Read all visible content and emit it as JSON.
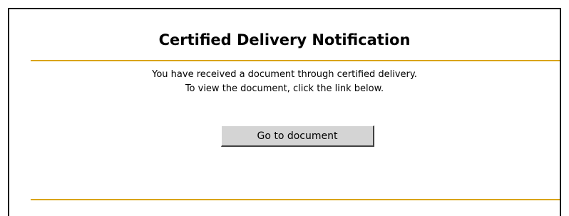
{
  "notification": {
    "title": "Certified Delivery Notification",
    "message_line1": "You have received a document through certified delivery.",
    "message_line2": "To view the document, click the link below.",
    "button_label": "Go to document"
  },
  "colors": {
    "rule_accent": "#d9a400",
    "border": "#000000",
    "button_face": "#d4d4d4"
  }
}
